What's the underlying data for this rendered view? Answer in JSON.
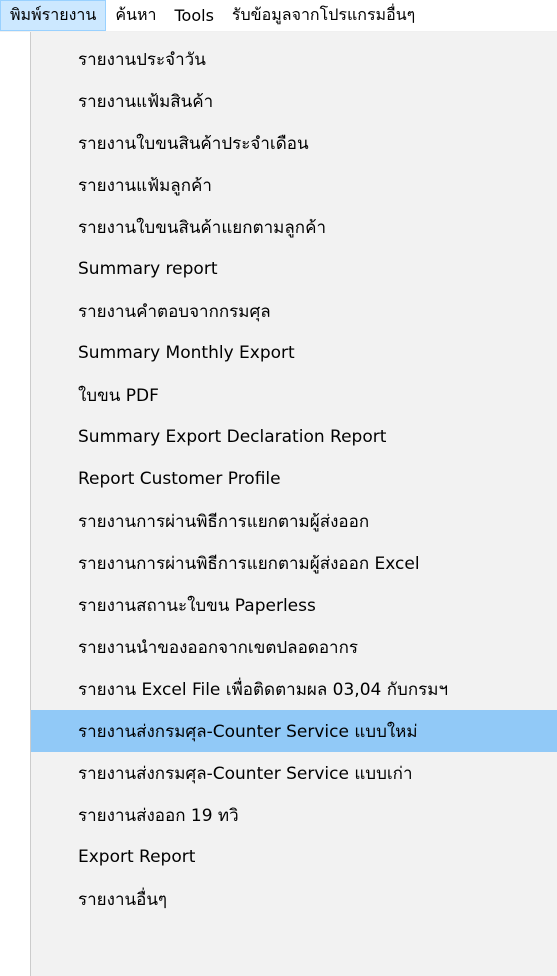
{
  "menubar": {
    "items": [
      {
        "label": "พิมพ์รายงาน",
        "active": true
      },
      {
        "label": "ค้นหา",
        "active": false
      },
      {
        "label": "Tools",
        "active": false
      },
      {
        "label": "รับข้อมูลจากโปรแกรมอื่นๆ",
        "active": false
      }
    ]
  },
  "dropdown": {
    "highlighted_index": 17,
    "items": [
      {
        "label": "รายงานประจำวัน"
      },
      {
        "label": "รายงานแฟ้มสินค้า"
      },
      {
        "label": "รายงานใบขนสินค้าประจำเดือน"
      },
      {
        "label": "รายงานแฟ้มลูกค้า"
      },
      {
        "label": "รายงานใบขนสินค้าแยกตามลูกค้า"
      },
      {
        "label": "Summary report"
      },
      {
        "label": "รายงานคำตอบจากกรมศุล"
      },
      {
        "label": "Summary Monthly Export"
      },
      {
        "label": "ใบขน PDF"
      },
      {
        "label": "Summary Export Declaration Report"
      },
      {
        "label": "Report Customer Profile"
      },
      {
        "label": "รายงานการผ่านพิธีการแยกตามผู้ส่งออก"
      },
      {
        "label": "รายงานการผ่านพิธีการแยกตามผู้ส่งออก Excel"
      },
      {
        "label": "รายงานสถานะใบขน Paperless"
      },
      {
        "label": "รายงานนำของออกจากเขตปลอดอากร"
      },
      {
        "label": "รายงาน Excel File เพื่อติดตามผล 03,04 กับกรมฯ"
      },
      {
        "label": "รายงานส่งกรมศุล-Counter Service แบบใหม่"
      },
      {
        "label": "รายงานส่งกรมศุล-Counter Service แบบใหม่"
      },
      {
        "label": "รายงานส่งกรมศุล-Counter Service แบบเก่า"
      },
      {
        "label": "รายงานส่งออก 19 ทวิ"
      },
      {
        "label": "Export Report"
      },
      {
        "label": "รายงานอื่นๆ"
      }
    ]
  }
}
